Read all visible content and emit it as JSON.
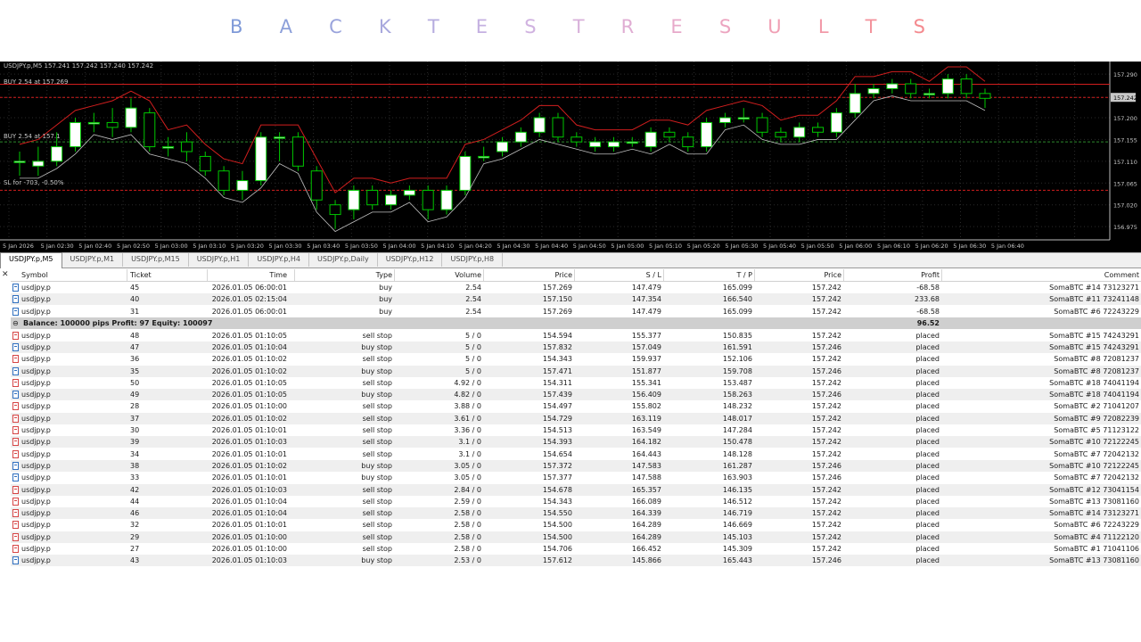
{
  "title": {
    "letters": [
      "B",
      "A",
      "C",
      "K",
      "T",
      "E",
      "S",
      "T",
      "R",
      "E",
      "S",
      "U",
      "L",
      "T",
      "S"
    ],
    "colors": [
      "#7f9ad8",
      "#8da0da",
      "#9aa4dc",
      "#a8a8dd",
      "#b6acdf",
      "#c4b0e1",
      "#d0b2e0",
      "#d8b0da",
      "#e0add3",
      "#e7a9ca",
      "#ecA5c0",
      "#f0a0b5",
      "#f29aa9",
      "#f3939c",
      "#f48a8f"
    ]
  },
  "chart": {
    "header": "USDJPY.p,M5  157.241 157.242 157.240 157.242",
    "labels": {
      "buy1": "BUY 2.54 at 157.269",
      "buy2": "BUY 2.54 at 157.1",
      "sl": "SL for -703, -0.50%"
    },
    "price_ticks": [
      "157.290",
      "157.242",
      "157.200",
      "157.155",
      "157.110",
      "157.065",
      "157.020",
      "156.975"
    ],
    "time_ticks": [
      "5 Jan 2026",
      "5 Jan 02:30",
      "5 Jan 02:40",
      "5 Jan 02:50",
      "5 Jan 03:00",
      "5 Jan 03:10",
      "5 Jan 03:20",
      "5 Jan 03:30",
      "5 Jan 03:40",
      "5 Jan 03:50",
      "5 Jan 04:00",
      "5 Jan 04:10",
      "5 Jan 04:20",
      "5 Jan 04:30",
      "5 Jan 04:40",
      "5 Jan 04:50",
      "5 Jan 05:00",
      "5 Jan 05:10",
      "5 Jan 05:20",
      "5 Jan 05:30",
      "5 Jan 05:40",
      "5 Jan 05:50",
      "5 Jan 06:00",
      "5 Jan 06:10",
      "5 Jan 06:20",
      "5 Jan 06:30",
      "5 Jan 06:40"
    ],
    "candles": [
      {
        "o": 157.11,
        "c": 157.11,
        "h": 157.13,
        "l": 157.08
      },
      {
        "o": 157.1,
        "c": 157.11,
        "h": 157.14,
        "l": 157.08
      },
      {
        "o": 157.11,
        "c": 157.14,
        "h": 157.17,
        "l": 157.1
      },
      {
        "o": 157.14,
        "c": 157.19,
        "h": 157.2,
        "l": 157.13
      },
      {
        "o": 157.19,
        "c": 157.19,
        "h": 157.21,
        "l": 157.17
      },
      {
        "o": 157.19,
        "c": 157.18,
        "h": 157.22,
        "l": 157.16
      },
      {
        "o": 157.18,
        "c": 157.22,
        "h": 157.24,
        "l": 157.17
      },
      {
        "o": 157.21,
        "c": 157.14,
        "h": 157.22,
        "l": 157.13
      },
      {
        "o": 157.14,
        "c": 157.14,
        "h": 157.16,
        "l": 157.12
      },
      {
        "o": 157.15,
        "c": 157.13,
        "h": 157.17,
        "l": 157.11
      },
      {
        "o": 157.12,
        "c": 157.09,
        "h": 157.13,
        "l": 157.08
      },
      {
        "o": 157.09,
        "c": 157.05,
        "h": 157.1,
        "l": 157.04
      },
      {
        "o": 157.05,
        "c": 157.07,
        "h": 157.09,
        "l": 157.03
      },
      {
        "o": 157.07,
        "c": 157.16,
        "h": 157.17,
        "l": 157.06
      },
      {
        "o": 157.16,
        "c": 157.16,
        "h": 157.17,
        "l": 157.11
      },
      {
        "o": 157.16,
        "c": 157.1,
        "h": 157.17,
        "l": 157.09
      },
      {
        "o": 157.09,
        "c": 157.03,
        "h": 157.1,
        "l": 157.01
      },
      {
        "o": 157.02,
        "c": 157.0,
        "h": 157.03,
        "l": 156.97
      },
      {
        "o": 157.01,
        "c": 157.05,
        "h": 157.06,
        "l": 156.99
      },
      {
        "o": 157.05,
        "c": 157.02,
        "h": 157.06,
        "l": 157.01
      },
      {
        "o": 157.02,
        "c": 157.04,
        "h": 157.05,
        "l": 157.01
      },
      {
        "o": 157.04,
        "c": 157.05,
        "h": 157.06,
        "l": 157.03
      },
      {
        "o": 157.05,
        "c": 157.01,
        "h": 157.06,
        "l": 156.99
      },
      {
        "o": 157.01,
        "c": 157.05,
        "h": 157.06,
        "l": 157.0
      },
      {
        "o": 157.05,
        "c": 157.12,
        "h": 157.13,
        "l": 157.04
      },
      {
        "o": 157.12,
        "c": 157.12,
        "h": 157.14,
        "l": 157.11
      },
      {
        "o": 157.13,
        "c": 157.15,
        "h": 157.16,
        "l": 157.12
      },
      {
        "o": 157.15,
        "c": 157.17,
        "h": 157.18,
        "l": 157.14
      },
      {
        "o": 157.17,
        "c": 157.2,
        "h": 157.21,
        "l": 157.16
      },
      {
        "o": 157.2,
        "c": 157.16,
        "h": 157.21,
        "l": 157.15
      },
      {
        "o": 157.16,
        "c": 157.15,
        "h": 157.17,
        "l": 157.14
      },
      {
        "o": 157.14,
        "c": 157.15,
        "h": 157.16,
        "l": 157.13
      },
      {
        "o": 157.14,
        "c": 157.15,
        "h": 157.16,
        "l": 157.13
      },
      {
        "o": 157.15,
        "c": 157.15,
        "h": 157.16,
        "l": 157.14
      },
      {
        "o": 157.14,
        "c": 157.17,
        "h": 157.18,
        "l": 157.13
      },
      {
        "o": 157.17,
        "c": 157.16,
        "h": 157.18,
        "l": 157.15
      },
      {
        "o": 157.16,
        "c": 157.14,
        "h": 157.17,
        "l": 157.13
      },
      {
        "o": 157.14,
        "c": 157.19,
        "h": 157.2,
        "l": 157.13
      },
      {
        "o": 157.19,
        "c": 157.2,
        "h": 157.21,
        "l": 157.18
      },
      {
        "o": 157.2,
        "c": 157.2,
        "h": 157.22,
        "l": 157.19
      },
      {
        "o": 157.2,
        "c": 157.17,
        "h": 157.21,
        "l": 157.16
      },
      {
        "o": 157.17,
        "c": 157.16,
        "h": 157.18,
        "l": 157.15
      },
      {
        "o": 157.16,
        "c": 157.18,
        "h": 157.19,
        "l": 157.15
      },
      {
        "o": 157.18,
        "c": 157.17,
        "h": 157.19,
        "l": 157.16
      },
      {
        "o": 157.17,
        "c": 157.21,
        "h": 157.22,
        "l": 157.16
      },
      {
        "o": 157.21,
        "c": 157.25,
        "h": 157.27,
        "l": 157.2
      },
      {
        "o": 157.25,
        "c": 157.26,
        "h": 157.27,
        "l": 157.24
      },
      {
        "o": 157.26,
        "c": 157.27,
        "h": 157.28,
        "l": 157.25
      },
      {
        "o": 157.27,
        "c": 157.25,
        "h": 157.28,
        "l": 157.24
      },
      {
        "o": 157.25,
        "c": 157.25,
        "h": 157.26,
        "l": 157.24
      },
      {
        "o": 157.25,
        "c": 157.28,
        "h": 157.29,
        "l": 157.24
      },
      {
        "o": 157.28,
        "c": 157.25,
        "h": 157.29,
        "l": 157.24
      },
      {
        "o": 157.25,
        "c": 157.24,
        "h": 157.26,
        "l": 157.22
      }
    ]
  },
  "tabs": [
    "USDJPY.p,M5",
    "USDJPY.p,M1",
    "USDJPY.p,M15",
    "USDJPY.p,H1",
    "USDJPY.p,H4",
    "USDJPY.p,Daily",
    "USDJPY.p,H12",
    "USDJPY.p,H8"
  ],
  "columns": [
    "Symbol",
    "Ticket",
    "Time",
    "Type",
    "Volume",
    "Price",
    "S / L",
    "T / P",
    "Price",
    "Profit",
    "Comment"
  ],
  "open_positions": [
    [
      "usdjpy.p",
      "45",
      "2026.01.05 06:00:01",
      "buy",
      "2.54",
      "157.269",
      "147.479",
      "165.099",
      "157.242",
      "-68.58",
      "SomaBTC #14 73123271"
    ],
    [
      "usdjpy.p",
      "40",
      "2026.01.05 02:15:04",
      "buy",
      "2.54",
      "157.150",
      "147.354",
      "166.540",
      "157.242",
      "233.68",
      "SomaBTC #11 73241148"
    ],
    [
      "usdjpy.p",
      "31",
      "2026.01.05 06:00:01",
      "buy",
      "2.54",
      "157.269",
      "147.479",
      "165.099",
      "157.242",
      "-68.58",
      "SomaBTC #6 72243229"
    ]
  ],
  "summary": {
    "text": "Balance: 100000 pips   Profit: 97   Equity: 100097",
    "profit": "96.52"
  },
  "pending_orders": [
    [
      "usdjpy.p",
      "48",
      "2026.01.05 01:10:05",
      "sell stop",
      "5 / 0",
      "154.594",
      "155.377",
      "150.835",
      "157.242",
      "placed",
      "SomaBTC #15 74243291",
      "red"
    ],
    [
      "usdjpy.p",
      "47",
      "2026.01.05 01:10:04",
      "buy stop",
      "5 / 0",
      "157.832",
      "157.049",
      "161.591",
      "157.246",
      "placed",
      "SomaBTC #15 74243291",
      "blue"
    ],
    [
      "usdjpy.p",
      "36",
      "2026.01.05 01:10:02",
      "sell stop",
      "5 / 0",
      "154.343",
      "159.937",
      "152.106",
      "157.242",
      "placed",
      "SomaBTC #8 72081237",
      "red"
    ],
    [
      "usdjpy.p",
      "35",
      "2026.01.05 01:10:02",
      "buy stop",
      "5 / 0",
      "157.471",
      "151.877",
      "159.708",
      "157.246",
      "placed",
      "SomaBTC #8 72081237",
      "blue"
    ],
    [
      "usdjpy.p",
      "50",
      "2026.01.05 01:10:05",
      "sell stop",
      "4.92 / 0",
      "154.311",
      "155.341",
      "153.487",
      "157.242",
      "placed",
      "SomaBTC #18 74041194",
      "red"
    ],
    [
      "usdjpy.p",
      "49",
      "2026.01.05 01:10:05",
      "buy stop",
      "4.82 / 0",
      "157.439",
      "156.409",
      "158.263",
      "157.246",
      "placed",
      "SomaBTC #18 74041194",
      "blue"
    ],
    [
      "usdjpy.p",
      "28",
      "2026.01.05 01:10:00",
      "sell stop",
      "3.88 / 0",
      "154.497",
      "155.802",
      "148.232",
      "157.242",
      "placed",
      "SomaBTC #2 71041207",
      "red"
    ],
    [
      "usdjpy.p",
      "37",
      "2026.01.05 01:10:02",
      "sell stop",
      "3.61 / 0",
      "154.729",
      "163.119",
      "148.017",
      "157.242",
      "placed",
      "SomaBTC #9 72082239",
      "red"
    ],
    [
      "usdjpy.p",
      "30",
      "2026.01.05 01:10:01",
      "sell stop",
      "3.36 / 0",
      "154.513",
      "163.549",
      "147.284",
      "157.242",
      "placed",
      "SomaBTC #5 71123122",
      "red"
    ],
    [
      "usdjpy.p",
      "39",
      "2026.01.05 01:10:03",
      "sell stop",
      "3.1 / 0",
      "154.393",
      "164.182",
      "150.478",
      "157.242",
      "placed",
      "SomaBTC #10 72122245",
      "red"
    ],
    [
      "usdjpy.p",
      "34",
      "2026.01.05 01:10:01",
      "sell stop",
      "3.1 / 0",
      "154.654",
      "164.443",
      "148.128",
      "157.242",
      "placed",
      "SomaBTC #7 72042132",
      "red"
    ],
    [
      "usdjpy.p",
      "38",
      "2026.01.05 01:10:02",
      "buy stop",
      "3.05 / 0",
      "157.372",
      "147.583",
      "161.287",
      "157.246",
      "placed",
      "SomaBTC #10 72122245",
      "blue"
    ],
    [
      "usdjpy.p",
      "33",
      "2026.01.05 01:10:01",
      "buy stop",
      "3.05 / 0",
      "157.377",
      "147.588",
      "163.903",
      "157.246",
      "placed",
      "SomaBTC #7 72042132",
      "blue"
    ],
    [
      "usdjpy.p",
      "42",
      "2026.01.05 01:10:03",
      "sell stop",
      "2.84 / 0",
      "154.678",
      "165.357",
      "146.135",
      "157.242",
      "placed",
      "SomaBTC #12 73041154",
      "red"
    ],
    [
      "usdjpy.p",
      "44",
      "2026.01.05 01:10:04",
      "sell stop",
      "2.59 / 0",
      "154.343",
      "166.089",
      "146.512",
      "157.242",
      "placed",
      "SomaBTC #13 73081160",
      "red"
    ],
    [
      "usdjpy.p",
      "46",
      "2026.01.05 01:10:04",
      "sell stop",
      "2.58 / 0",
      "154.550",
      "164.339",
      "146.719",
      "157.242",
      "placed",
      "SomaBTC #14 73123271",
      "red"
    ],
    [
      "usdjpy.p",
      "32",
      "2026.01.05 01:10:01",
      "sell stop",
      "2.58 / 0",
      "154.500",
      "164.289",
      "146.669",
      "157.242",
      "placed",
      "SomaBTC #6 72243229",
      "red"
    ],
    [
      "usdjpy.p",
      "29",
      "2026.01.05 01:10:00",
      "sell stop",
      "2.58 / 0",
      "154.500",
      "164.289",
      "145.103",
      "157.242",
      "placed",
      "SomaBTC #4 71122120",
      "red"
    ],
    [
      "usdjpy.p",
      "27",
      "2026.01.05 01:10:00",
      "sell stop",
      "2.58 / 0",
      "154.706",
      "166.452",
      "145.309",
      "157.242",
      "placed",
      "SomaBTC #1 71041106",
      "red"
    ],
    [
      "usdjpy.p",
      "43",
      "2026.01.05 01:10:03",
      "buy stop",
      "2.53 / 0",
      "157.612",
      "145.866",
      "165.443",
      "157.246",
      "placed",
      "SomaBTC #13 73081160",
      "blue"
    ]
  ],
  "colors": {
    "bull": "#ffffff",
    "bear": "#000000",
    "candle_outline": "#00c800",
    "envelope_upper": "#d21e1e",
    "envelope_lower": "#c0c0c0",
    "order_line": "#d21e1e",
    "grid": "#2a2a2a"
  }
}
